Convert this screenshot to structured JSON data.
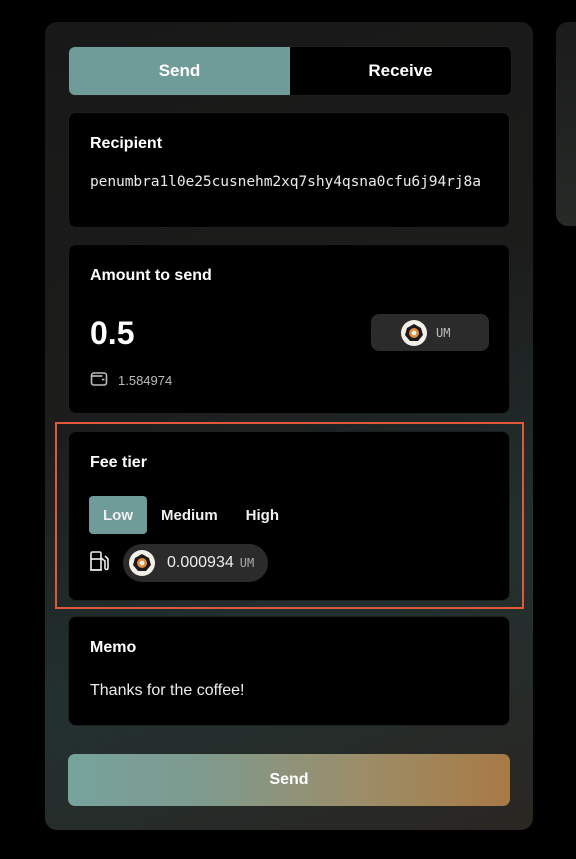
{
  "tabs": {
    "send": "Send",
    "receive": "Receive"
  },
  "recipient": {
    "label": "Recipient",
    "value": "penumbra1l0e25cusnehm2xq7shy4qsna0cfu6j94rj8a"
  },
  "amount": {
    "label": "Amount to send",
    "value": "0.5",
    "asset_symbol": "UM",
    "balance": "1.584974"
  },
  "fee": {
    "label": "Fee tier",
    "options": [
      "Low",
      "Medium",
      "High"
    ],
    "selected": "Low",
    "amount": "0.000934",
    "asset_symbol": "UM"
  },
  "memo": {
    "label": "Memo",
    "value": "Thanks for the coffee!"
  },
  "actions": {
    "send_label": "Send"
  },
  "colors": {
    "accent": "#6f9c98",
    "highlight_border": "#e0593a",
    "button_gradient_start": "#76a39d",
    "button_gradient_end": "#a87a45"
  }
}
